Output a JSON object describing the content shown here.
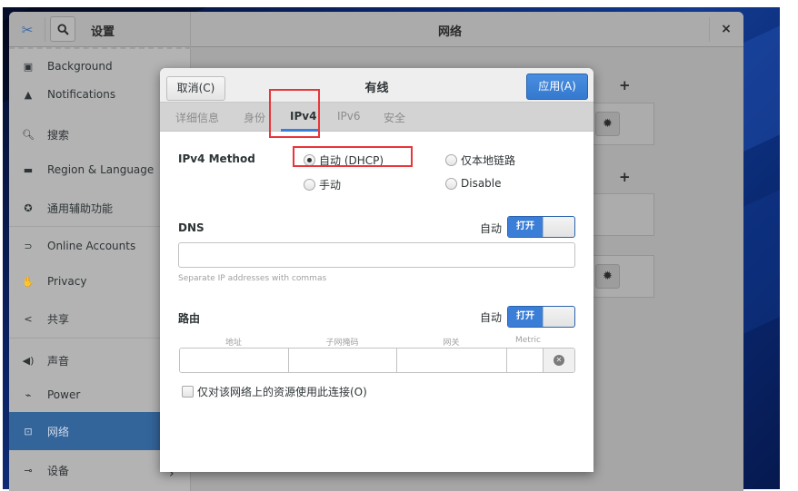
{
  "window": {
    "app_title": "设置",
    "panel_title": "网络",
    "close_label": "×"
  },
  "sidebar": {
    "items": [
      {
        "label": "Background",
        "icon": "background-icon",
        "glyph": "▣"
      },
      {
        "label": "Notifications",
        "icon": "bell-icon",
        "glyph": "▲"
      },
      {
        "label": "搜索",
        "icon": "search-icon",
        "glyph": "🔍︎"
      },
      {
        "label": "Region & Language",
        "icon": "region-icon",
        "glyph": "▬"
      },
      {
        "label": "通用辅助功能",
        "icon": "accessibility-icon",
        "glyph": "✪"
      },
      {
        "label": "Online Accounts",
        "icon": "online-accounts-icon",
        "glyph": "⊃"
      },
      {
        "label": "Privacy",
        "icon": "privacy-hand-icon",
        "glyph": "✋"
      },
      {
        "label": "共享",
        "icon": "share-icon",
        "glyph": "<"
      },
      {
        "label": "声音",
        "icon": "speaker-icon",
        "glyph": "◀)"
      },
      {
        "label": "Power",
        "icon": "power-icon",
        "glyph": "⌁"
      },
      {
        "label": "网络",
        "icon": "network-icon",
        "glyph": "⊡",
        "selected": true
      },
      {
        "label": "设备",
        "icon": "devices-icon",
        "glyph": "⊸"
      }
    ],
    "chevron": "›"
  },
  "background_panel": {
    "add_label": "+",
    "gear_glyph": "✹"
  },
  "dialog": {
    "title": "有线",
    "cancel_label": "取消(C)",
    "apply_label": "应用(A)",
    "tabs": [
      {
        "label": "详细信息",
        "active": false
      },
      {
        "label": "身份",
        "active": false
      },
      {
        "label": "IPv4",
        "active": true
      },
      {
        "label": "IPv6",
        "active": false
      },
      {
        "label": "安全",
        "active": false
      }
    ],
    "ipv4_method": {
      "label": "IPv4 Method",
      "options": [
        {
          "label": "自动 (DHCP)",
          "selected": true
        },
        {
          "label": "仅本地链路",
          "selected": false
        },
        {
          "label": "手动",
          "selected": false
        },
        {
          "label": "Disable",
          "selected": false
        }
      ]
    },
    "dns": {
      "label": "DNS",
      "auto_label": "自动",
      "switch_label": "打开",
      "switch_on": true,
      "input_value": "",
      "hint": "Separate IP addresses with commas"
    },
    "routes": {
      "label": "路由",
      "auto_label": "自动",
      "switch_label": "打开",
      "switch_on": true,
      "columns": [
        "地址",
        "子网掩码",
        "网关",
        "Metric"
      ],
      "rows": [
        {
          "address": "",
          "netmask": "",
          "gateway": "",
          "metric": ""
        }
      ]
    },
    "only_local_resources": {
      "label": "仅对该网络上的资源使用此连接(O)",
      "checked": false
    }
  },
  "annotations": {
    "highlight_color": "#e8363a"
  },
  "colors": {
    "accent": "#3b7ed8",
    "sidebar_selected": "#33649a"
  }
}
